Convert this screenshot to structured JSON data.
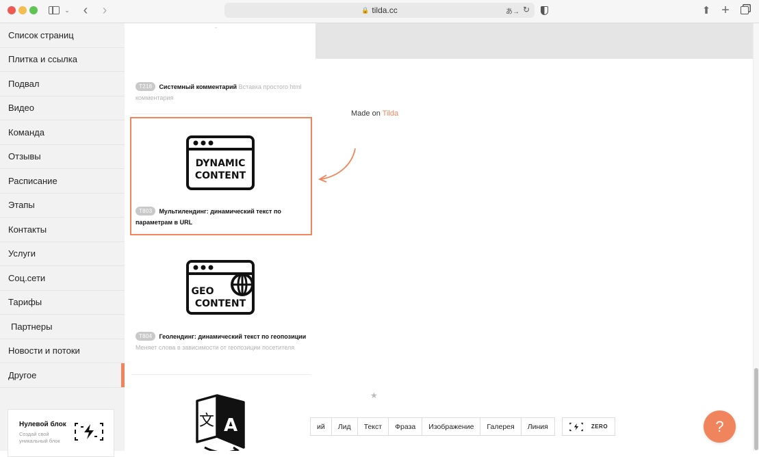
{
  "browser": {
    "url": "tilda.cc",
    "icons": [
      "sidebar-toggle-icon",
      "chevron-down-icon",
      "back-icon",
      "forward-icon",
      "lock-icon",
      "translate-icon",
      "reload-icon",
      "shield-icon",
      "share-icon",
      "plus-icon",
      "tabs-icon"
    ]
  },
  "sidebar": {
    "items": [
      {
        "label": "Список страниц"
      },
      {
        "label": "Плитка и ссылка"
      },
      {
        "label": "Подвал"
      },
      {
        "label": "Видео"
      },
      {
        "label": "Команда"
      },
      {
        "label": "Отзывы"
      },
      {
        "label": "Расписание"
      },
      {
        "label": "Этапы"
      },
      {
        "label": "Контакты"
      },
      {
        "label": "Услуги"
      },
      {
        "label": "Соц.сети"
      },
      {
        "label": "Тарифы"
      },
      {
        "label": "Партнеры"
      },
      {
        "label": "Новости и потоки"
      },
      {
        "label": "Другое"
      }
    ],
    "active_item": "Другое",
    "zero_block": {
      "title": "Нулевой блок",
      "description": "Создай свой уникальный блок"
    }
  },
  "blocks": {
    "items": [
      {
        "code": "T218",
        "name": "Системный комментарий",
        "hint": "Вставка простого html комментария"
      },
      {
        "code": "T803",
        "name": "Мультилендинг: динамический текст по параметрам в URL",
        "hint": "",
        "icon_text": [
          "DYNAMIC",
          "CONTENT"
        ],
        "highlighted": true
      },
      {
        "code": "T804",
        "name": "Геолендинг: динамический текст по геопозиции",
        "hint": "Меняет слова в зависимости от геопозиции посетителя",
        "icon_text": [
          "GEO",
          "CONTENT"
        ]
      },
      {
        "icon": "translate-book-icon"
      }
    ]
  },
  "preview": {
    "made_on_prefix": "Made on",
    "made_on_brand": "Tilda",
    "toolbar": [
      {
        "label": "ий"
      },
      {
        "label": "Лид"
      },
      {
        "label": "Текст"
      },
      {
        "label": "Фраза"
      },
      {
        "label": "Изображение"
      },
      {
        "label": "Галерея"
      },
      {
        "label": "Линия"
      }
    ],
    "zero_button_label": "ZERO",
    "help_label": "?"
  },
  "colors": {
    "accent": "#f0845c",
    "sidebar_bg": "#f2f2f2",
    "code_badge": "#c9c9c9"
  }
}
